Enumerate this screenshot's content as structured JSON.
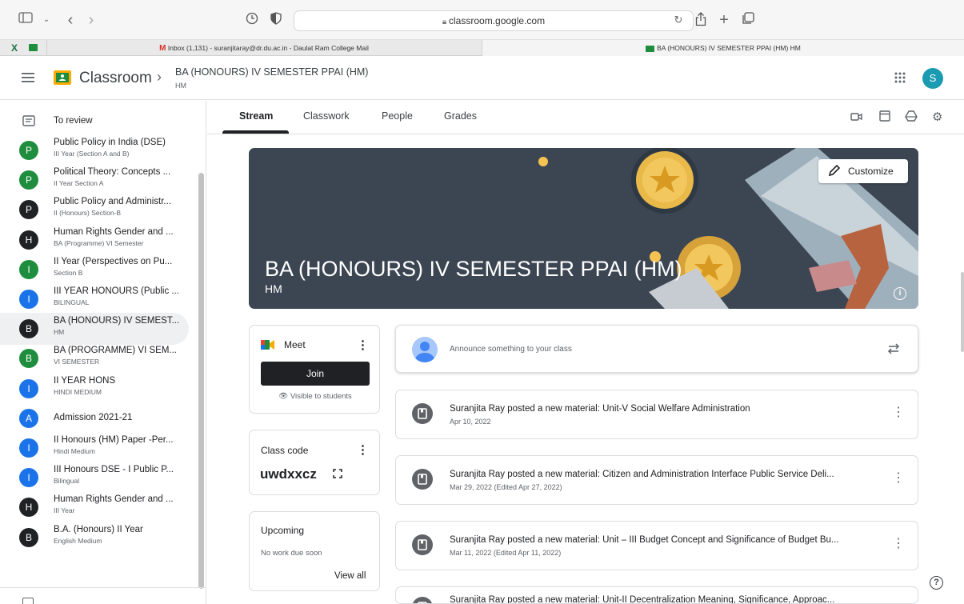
{
  "browser": {
    "url": "classroom.google.com",
    "tabs": [
      {
        "label": "Inbox (1,131) - suranjitaray@dr.du.ac.in - Daulat Ram College Mail"
      },
      {
        "label": "BA (HONOURS) IV SEMESTER PPAI (HM) HM"
      }
    ]
  },
  "header": {
    "app_name": "Classroom",
    "class_title": "BA (HONOURS) IV SEMESTER PPAI (HM)",
    "class_subtitle": "HM",
    "account_initial": "S"
  },
  "sidebar": {
    "to_review": "To review",
    "classes": [
      {
        "initial": "P",
        "name": "Public Policy in India (DSE)",
        "sub": "III Year (Section A and B)",
        "color": "#1e8e3e"
      },
      {
        "initial": "P",
        "name": "Political Theory: Concepts ...",
        "sub": "II Year Section A",
        "color": "#1e8e3e"
      },
      {
        "initial": "P",
        "name": "Public Policy and Administr...",
        "sub": "II (Honours) Section-B",
        "color": "#202124"
      },
      {
        "initial": "H",
        "name": "Human Rights Gender and ...",
        "sub": "BA (Programme) VI Semester",
        "color": "#202124"
      },
      {
        "initial": "I",
        "name": "II Year (Perspectives on Pu...",
        "sub": "Section B",
        "color": "#1e8e3e"
      },
      {
        "initial": "I",
        "name": "III YEAR HONOURS (Public ...",
        "sub": "BILINGUAL",
        "color": "#1a73e8"
      },
      {
        "initial": "B",
        "name": "BA (HONOURS) IV SEMEST...",
        "sub": "HM",
        "color": "#202124"
      },
      {
        "initial": "B",
        "name": "BA (PROGRAMME) VI SEM...",
        "sub": "VI SEMESTER",
        "color": "#1e8e3e"
      },
      {
        "initial": "I",
        "name": "II YEAR HONS",
        "sub": "HINDI MEDIUM",
        "color": "#1a73e8"
      },
      {
        "initial": "A",
        "name": "Admission 2021-21",
        "sub": "",
        "color": "#1a73e8"
      },
      {
        "initial": "I",
        "name": "II Honours (HM) Paper -Per...",
        "sub": "Hindi Medium",
        "color": "#1a73e8"
      },
      {
        "initial": "I",
        "name": "III Honours DSE - I Public P...",
        "sub": "Bilingual",
        "color": "#1a73e8"
      },
      {
        "initial": "H",
        "name": "Human Rights Gender and ...",
        "sub": "III Year",
        "color": "#202124"
      },
      {
        "initial": "B",
        "name": "B.A. (Honours) II Year",
        "sub": "English Medium",
        "color": "#202124"
      }
    ]
  },
  "nav": {
    "tabs": [
      "Stream",
      "Classwork",
      "People",
      "Grades"
    ]
  },
  "banner": {
    "title": "BA (HONOURS) IV SEMESTER PPAI (HM)",
    "subtitle": "HM",
    "customize_label": "Customize",
    "info_icon": "info-icon"
  },
  "meet": {
    "label": "Meet",
    "join_label": "Join",
    "visibility": "Visible to students"
  },
  "class_code": {
    "label": "Class code",
    "code": "uwdxxcz"
  },
  "upcoming": {
    "label": "Upcoming",
    "status": "No work due soon",
    "view_all": "View all"
  },
  "announce": {
    "placeholder": "Announce something to your class"
  },
  "posts": [
    {
      "title": "Suranjita Ray posted a new material: Unit-V Social Welfare Administration",
      "date": "Apr 10, 2022"
    },
    {
      "title": "Suranjita Ray posted a new material: Citizen and Administration Interface Public Service Deli...",
      "date": "Mar 29, 2022 (Edited Apr 27, 2022)"
    },
    {
      "title": "Suranjita Ray posted a new material: Unit – III Budget Concept and Significance of Budget Bu...",
      "date": "Mar 11, 2022 (Edited Apr 11, 2022)"
    },
    {
      "title": "Suranjita Ray posted a new material: Unit-II Decentralization Meaning, Significance, Approac...",
      "date": ""
    }
  ],
  "colors": {
    "accent_blue": "#1a73e8",
    "green": "#1e8e3e",
    "banner_bg": "#3c4652"
  }
}
